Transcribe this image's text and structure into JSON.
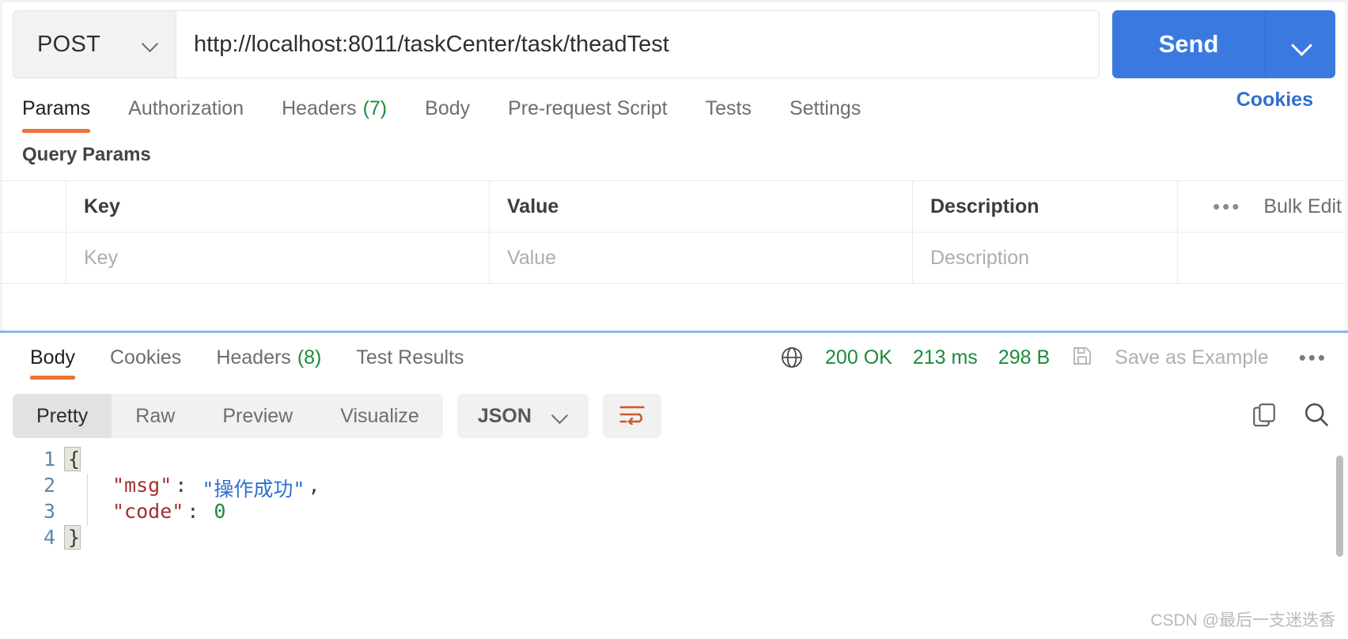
{
  "request": {
    "method": "POST",
    "method_caret_icon": "chevron-down-icon",
    "url": "http://localhost:8011/taskCenter/task/theadTest",
    "send_label": "Send",
    "send_caret_icon": "chevron-down-icon"
  },
  "request_tabs": [
    {
      "label": "Params",
      "count": "",
      "active": true
    },
    {
      "label": "Authorization",
      "count": "",
      "active": false
    },
    {
      "label": "Headers",
      "count": "(7)",
      "active": false
    },
    {
      "label": "Body",
      "count": "",
      "active": false
    },
    {
      "label": "Pre-request Script",
      "count": "",
      "active": false
    },
    {
      "label": "Tests",
      "count": "",
      "active": false
    },
    {
      "label": "Settings",
      "count": "",
      "active": false
    }
  ],
  "cookies_link": "Cookies",
  "query_params": {
    "title": "Query Params",
    "headers": {
      "key": "Key",
      "value": "Value",
      "description": "Description"
    },
    "placeholders": {
      "key": "Key",
      "value": "Value",
      "description": "Description"
    },
    "bulk_edit_label": "Bulk Edit",
    "bulk_menu_icon": "ellipsis-icon"
  },
  "response_tabs": [
    {
      "label": "Body",
      "count": "",
      "active": true
    },
    {
      "label": "Cookies",
      "count": "",
      "active": false
    },
    {
      "label": "Headers",
      "count": "(8)",
      "active": false
    },
    {
      "label": "Test Results",
      "count": "",
      "active": false
    }
  ],
  "response_meta": {
    "network_icon": "globe-icon",
    "status": "200 OK",
    "time": "213 ms",
    "size": "298 B",
    "save_icon": "floppy-disk-icon",
    "save_label": "Save as Example",
    "more_icon": "ellipsis-icon"
  },
  "body_toolbar": {
    "views": [
      {
        "label": "Pretty",
        "active": true
      },
      {
        "label": "Raw",
        "active": false
      },
      {
        "label": "Preview",
        "active": false
      },
      {
        "label": "Visualize",
        "active": false
      }
    ],
    "format": "JSON",
    "format_caret_icon": "chevron-down-icon",
    "wrap_icon": "wrap-lines-icon",
    "copy_icon": "copy-icon",
    "search_icon": "search-icon"
  },
  "response_body": {
    "lines": [
      {
        "num": "1",
        "indent": 0,
        "tokens": [
          {
            "t": "brace-open",
            "v": "{"
          }
        ]
      },
      {
        "num": "2",
        "indent": 1,
        "tokens": [
          {
            "t": "key",
            "v": "\"msg\""
          },
          {
            "t": "punc",
            "v": ": "
          },
          {
            "t": "str",
            "v": "\"操作成功\""
          },
          {
            "t": "punc",
            "v": ","
          }
        ]
      },
      {
        "num": "3",
        "indent": 1,
        "tokens": [
          {
            "t": "key",
            "v": "\"code\""
          },
          {
            "t": "punc",
            "v": ": "
          },
          {
            "t": "num",
            "v": "0"
          }
        ]
      },
      {
        "num": "4",
        "indent": 0,
        "tokens": [
          {
            "t": "brace-close",
            "v": "}"
          }
        ]
      }
    ]
  },
  "watermark": "CSDN @最后一支迷迭香",
  "colors": {
    "accent_orange": "#ef7339",
    "send_blue": "#3a7ae0",
    "link_blue": "#2f6fd0",
    "status_green": "#1c8b39",
    "splitter_blue": "#8cb4ec"
  }
}
